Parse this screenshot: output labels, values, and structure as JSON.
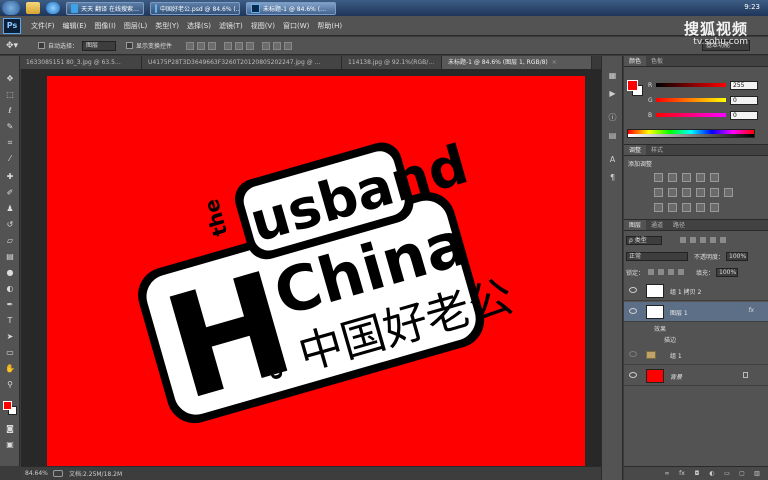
{
  "taskbar": {
    "tasks": [
      {
        "label": "天天 翻译 在线搜索…",
        "icon": "qq-icon"
      },
      {
        "label": "中国好老公.psd @ 84.6% (…",
        "icon": "photoshop-icon"
      },
      {
        "label": "未标题-1 @ 84.6% (…",
        "icon": "photoshop-icon"
      }
    ],
    "clock": "9:23"
  },
  "app": {
    "logo": "Ps",
    "menu": [
      "文件(F)",
      "编辑(E)",
      "图像(I)",
      "图层(L)",
      "类型(Y)",
      "选择(S)",
      "滤镜(T)",
      "视图(V)",
      "窗口(W)",
      "帮助(H)"
    ]
  },
  "watermark": {
    "brand": "搜狐视频",
    "url": "tv.sohu.com"
  },
  "options": {
    "tool_icon": "move-tool-icon",
    "auto_select_label": "自动选择：",
    "auto_select_value": "图层",
    "show_transform_label": "显示变换控件",
    "workspace": "基本功能"
  },
  "doc_tabs": [
    {
      "label": "1633085151 80_3.jpg @ 63.5…",
      "active": false
    },
    {
      "label": "U4175P28T3D3649663F3260T20120805202247.jpg @ …",
      "active": false
    },
    {
      "label": "114138.jpg @ 92.1%(RGB/…",
      "active": false
    },
    {
      "label": "未标题-1 @ 84.6% (图层 1, RGB/8)",
      "active": true
    }
  ],
  "artwork": {
    "canvas_color": "#ff0000",
    "letter_big": "H",
    "word_the": "the",
    "word_husband": "usband",
    "word_of": "of",
    "word_china": "China",
    "chinese": "中国好老公"
  },
  "status": {
    "zoom": "84.64%",
    "doc": "文档:2.25M/18.2M"
  },
  "color_panel": {
    "tabs": [
      "颜色",
      "色板"
    ],
    "channels": [
      {
        "name": "R",
        "value": "255",
        "gradient": "linear-gradient(90deg,#000,#ff0000)"
      },
      {
        "name": "G",
        "value": "0",
        "gradient": "linear-gradient(90deg,#ff0000,#ffff00)"
      },
      {
        "name": "B",
        "value": "0",
        "gradient": "linear-gradient(90deg,#ff0000,#ff00ff)"
      }
    ],
    "foreground": "#ff0000",
    "background": "#ffffff"
  },
  "adjustments": {
    "tabs": [
      "调整",
      "样式"
    ],
    "title": "添加调整"
  },
  "layers": {
    "tabs": [
      "图层",
      "通道",
      "路径"
    ],
    "filter_label": "ρ 类型",
    "blend_mode": "正常",
    "opacity_label": "不透明度：",
    "opacity": "100%",
    "lock_label": "锁定：",
    "fill_label": "填充：",
    "fill": "100%",
    "items": [
      {
        "name": "组 1 拷贝 2",
        "kind": "group"
      },
      {
        "name": "图层 1",
        "kind": "layer",
        "selected": true,
        "fx": "fx"
      },
      {
        "name": "组 1",
        "kind": "group"
      },
      {
        "name": "背景",
        "kind": "background"
      }
    ],
    "effects_label": "效果",
    "stroke_label": "描边"
  }
}
